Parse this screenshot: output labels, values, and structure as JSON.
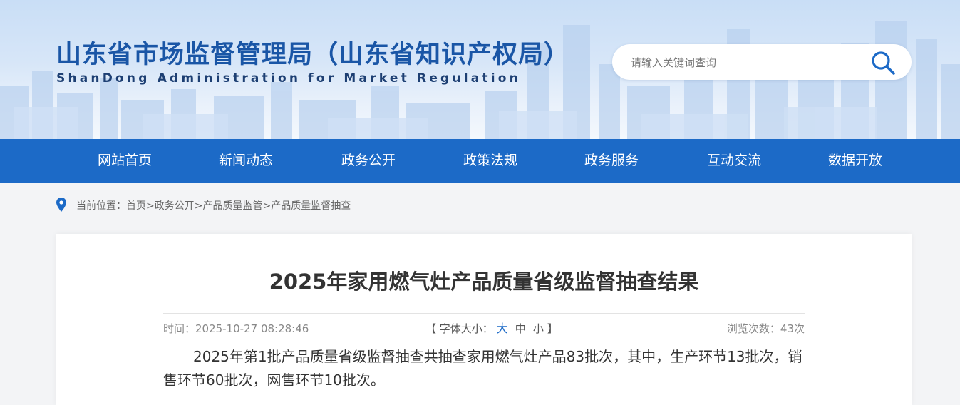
{
  "header": {
    "title": "山东省市场监督管理局（山东省知识产权局）",
    "subtitle": "ShanDong Administration for Market Regulation",
    "search_placeholder": "请输入关键词查询"
  },
  "nav": {
    "items": [
      "网站首页",
      "新闻动态",
      "政务公开",
      "政策法规",
      "政务服务",
      "互动交流",
      "数据开放"
    ]
  },
  "breadcrumb": {
    "prefix": "当前位置：",
    "items": [
      "首页",
      "政务公开",
      "产品质量监管",
      "产品质量监督抽查"
    ],
    "separator": ">"
  },
  "article": {
    "title": "2025年家用燃气灶产品质量省级监督抽查结果",
    "time_label": "时间：2025-10-27 08:28:46",
    "font_size_open": "【 字体大小：",
    "font_sizes": [
      "大",
      "中",
      "小"
    ],
    "font_size_close": "】",
    "views_label": "浏览次数：43次",
    "body": "2025年第1批产品质量省级监督抽查共抽查家用燃气灶产品83批次，其中，生产环节13批次，销售环节60批次，网售环节10批次。"
  },
  "colors": {
    "brand_blue": "#1c6ac7",
    "title_blue": "#1a56a6",
    "subtitle_navy": "#1d3f73"
  },
  "icons": [
    "search-icon",
    "location-pin-icon"
  ]
}
